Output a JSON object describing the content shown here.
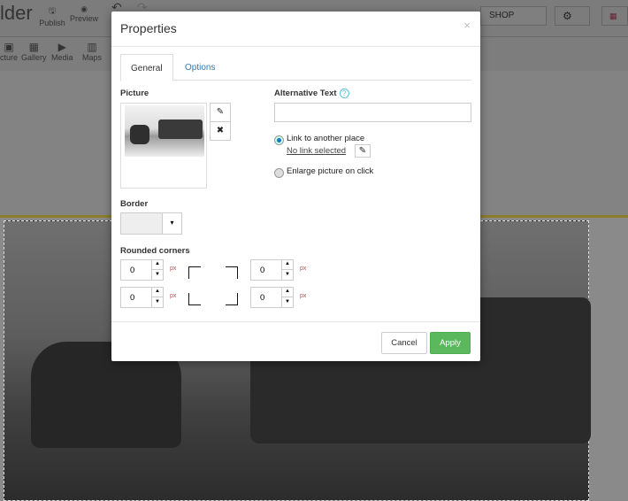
{
  "toolbar": {
    "logo": "lder",
    "publish": "Publish",
    "preview": "Preview",
    "picture": "cture",
    "gallery": "Gallery",
    "media": "Media",
    "maps": "Maps",
    "shop": "SHOP"
  },
  "modal": {
    "title": "Properties",
    "close": "×",
    "tabs": [
      {
        "label": "General",
        "active": true
      },
      {
        "label": "Options",
        "active": false
      }
    ],
    "picture_label": "Picture",
    "alt_label": "Alternative Text",
    "alt_value": "",
    "help": "?",
    "link_option": "Link to another place",
    "link_value": "No link selected",
    "link_selected": true,
    "enlarge_option": "Enlarge picture on click",
    "border_label": "Border",
    "dropdown": "▾",
    "rounded_label": "Rounded corners",
    "corners": {
      "top_left": "0",
      "top_right": "0",
      "bottom_left": "0",
      "bottom_right": "0"
    },
    "unit": "px",
    "cancel": "Cancel",
    "apply": "Apply"
  },
  "colors": {
    "accent": "#337ab7",
    "apply": "#5cb85c"
  }
}
